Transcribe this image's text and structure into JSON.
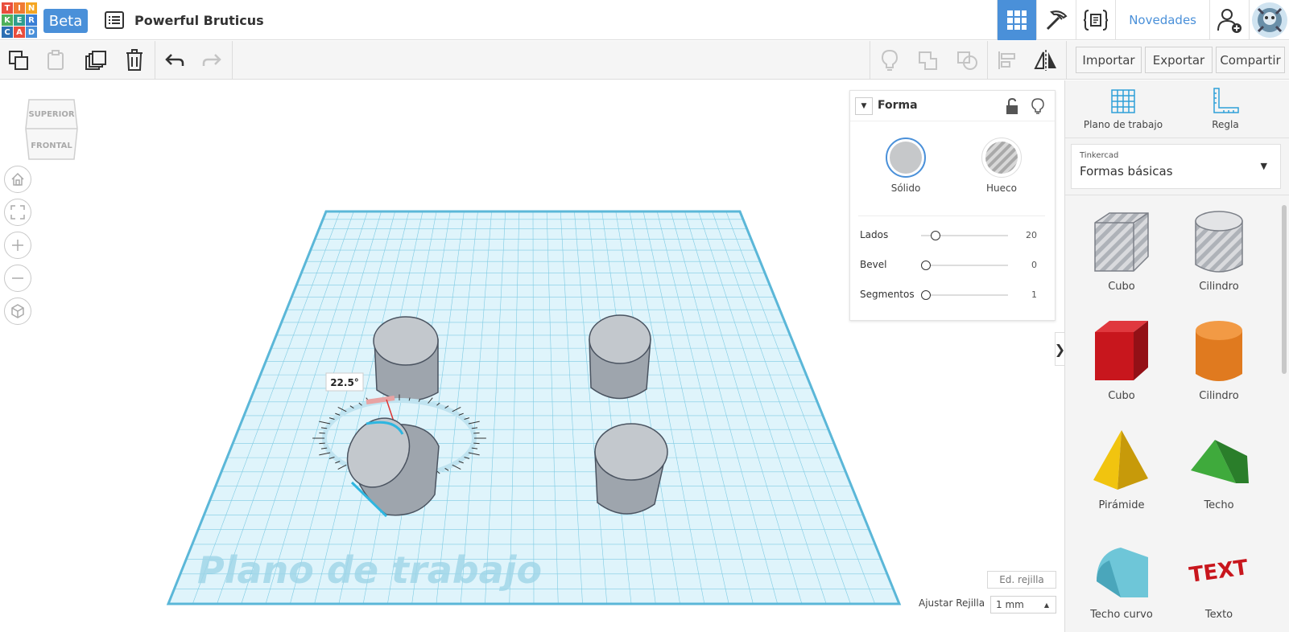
{
  "logo": {
    "letters": [
      "T",
      "I",
      "N",
      "K",
      "E",
      "R",
      "C",
      "A",
      "D"
    ],
    "colors": [
      "#e94e3d",
      "#f07a33",
      "#f5a623",
      "#4fb05c",
      "#2f9e8f",
      "#3a7fd5",
      "#2d6fb3",
      "#e94e3d",
      "#4a90d9"
    ]
  },
  "header": {
    "beta": "Beta",
    "project_title": "Powerful Bruticus",
    "novedades": "Novedades",
    "accent": "#4a90d9"
  },
  "toolbar": {
    "importar": "Importar",
    "exportar": "Exportar",
    "compartir": "Compartir"
  },
  "viewcube": {
    "top": "SUPERIOR",
    "front": "FRONTAL"
  },
  "workplane": {
    "label": "Plano de trabajo",
    "rotation_label": "22.5°",
    "edit_grid": "Ed. rejilla",
    "snap_label": "Ajustar Rejilla",
    "snap_value": "1 mm"
  },
  "shape_panel": {
    "title": "Forma",
    "solid_label": "Sólido",
    "hole_label": "Hueco",
    "params": [
      {
        "label": "Lados",
        "value": "20",
        "level": 0.11
      },
      {
        "label": "Bevel",
        "value": "0",
        "level": 0.0
      },
      {
        "label": "Segmentos",
        "value": "1",
        "level": 0.0
      }
    ]
  },
  "right_panel": {
    "workplane_tool": "Plano de trabajo",
    "ruler_tool": "Regla",
    "library_source": "Tinkercad",
    "library_name": "Formas básicas",
    "shapes": [
      "Cubo",
      "Cilindro",
      "Cubo",
      "Cilindro",
      "Pirámide",
      "Techo",
      "Techo curvo",
      "Texto"
    ]
  }
}
